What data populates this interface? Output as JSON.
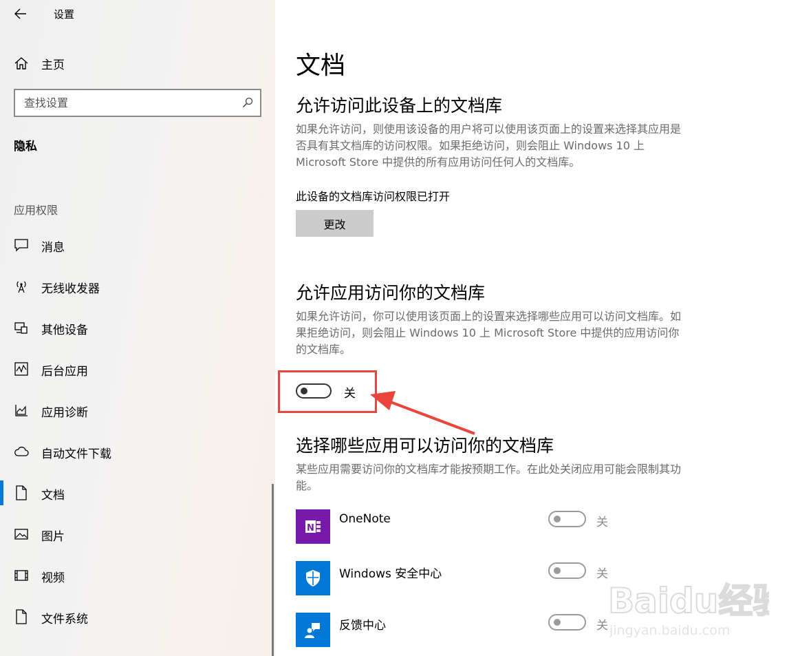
{
  "window": {
    "title": "设置"
  },
  "sidebar": {
    "home_label": "主页",
    "search_placeholder": "查找设置",
    "section_title": "隐私",
    "group_title": "应用权限",
    "items": [
      {
        "label": "消息",
        "icon": "message-icon"
      },
      {
        "label": "无线收发器",
        "icon": "antenna-icon"
      },
      {
        "label": "其他设备",
        "icon": "devices-icon"
      },
      {
        "label": "后台应用",
        "icon": "background-apps-icon"
      },
      {
        "label": "应用诊断",
        "icon": "diagnostics-icon"
      },
      {
        "label": "自动文件下载",
        "icon": "cloud-icon"
      },
      {
        "label": "文档",
        "icon": "document-icon",
        "active": true
      },
      {
        "label": "图片",
        "icon": "picture-icon"
      },
      {
        "label": "视频",
        "icon": "video-icon"
      },
      {
        "label": "文件系统",
        "icon": "file-icon"
      }
    ]
  },
  "main": {
    "title": "文档",
    "device_access": {
      "heading": "允许访问此设备上的文档库",
      "description": "如果允许访问，则使用该设备的用户将可以使用该页面上的设置来选择其应用是否具有其文档库的访问权限。如果拒绝访问，则会阻止 Windows 10 上 Microsoft Store 中提供的所有应用访问任何人的文档库。",
      "status": "此设备的文档库访问权限已打开",
      "change_label": "更改"
    },
    "app_access": {
      "heading": "允许应用访问你的文档库",
      "description": "如果允许访问，你可以使用该页面上的设置来选择哪些应用可以访问文档库。如果拒绝访问，则会阻止 Windows 10 上 Microsoft Store 中提供的应用访问你的文档库。",
      "toggle_label": "关",
      "toggle_on": false
    },
    "choose_apps": {
      "heading": "选择哪些应用可以访问你的文档库",
      "description": "某些应用需要访问你的文档库才能按预期工作。在此处关闭应用可能会限制其功能。",
      "apps": [
        {
          "name": "OneNote",
          "state": "关",
          "icon": "onenote-icon",
          "color": "#7719aa"
        },
        {
          "name": "Windows 安全中心",
          "state": "关",
          "icon": "shield-icon",
          "color": "#0078d7"
        },
        {
          "name": "反馈中心",
          "state": "关",
          "icon": "feedback-hub-icon",
          "color": "#0078d7"
        }
      ]
    }
  },
  "colors": {
    "accent": "#0078d7",
    "annotation": "#e8453c"
  },
  "watermark": {
    "brand": "Baidu经验",
    "url": "jingyan.baidu.com"
  }
}
